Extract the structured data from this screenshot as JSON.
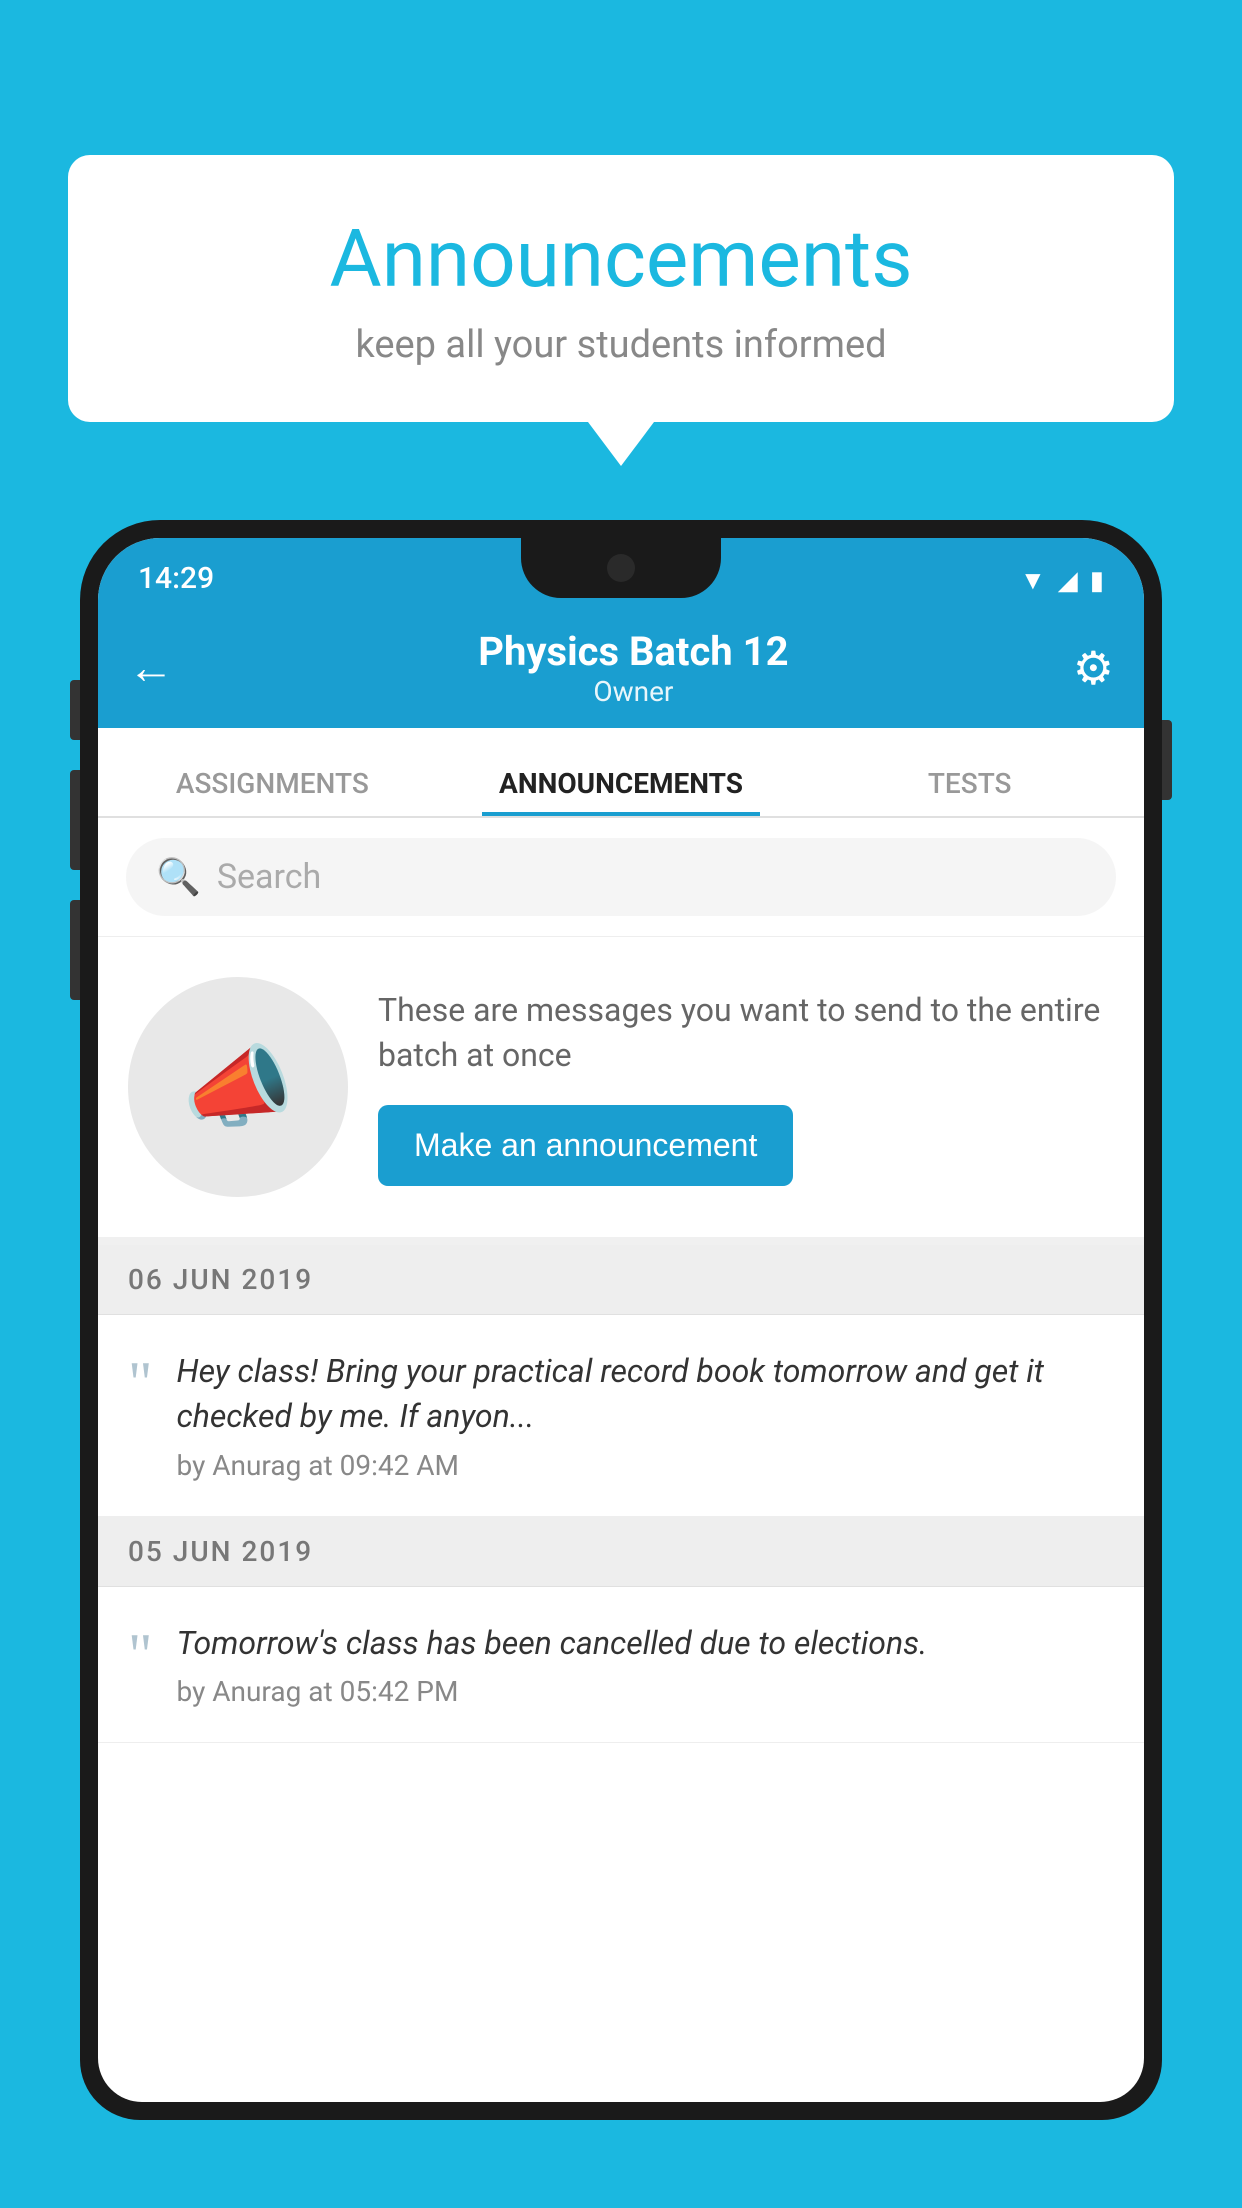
{
  "background_color": "#1bb8e0",
  "speech_bubble": {
    "title": "Announcements",
    "subtitle": "keep all your students informed"
  },
  "phone": {
    "status_bar": {
      "time": "14:29"
    },
    "header": {
      "title": "Physics Batch 12",
      "subtitle": "Owner",
      "back_label": "←",
      "gear_label": "⚙"
    },
    "tabs": [
      {
        "label": "ASSIGNMENTS",
        "active": false
      },
      {
        "label": "ANNOUNCEMENTS",
        "active": true
      },
      {
        "label": "TESTS",
        "active": false
      }
    ],
    "search": {
      "placeholder": "Search"
    },
    "promo": {
      "description": "These are messages you want to send to the entire batch at once",
      "button_label": "Make an announcement"
    },
    "announcements": [
      {
        "date": "06  JUN  2019",
        "text": "Hey class! Bring your practical record book tomorrow and get it checked by me. If anyon...",
        "meta": "by Anurag at 09:42 AM"
      },
      {
        "date": "05  JUN  2019",
        "text": "Tomorrow's class has been cancelled due to elections.",
        "meta": "by Anurag at 05:42 PM"
      }
    ]
  }
}
